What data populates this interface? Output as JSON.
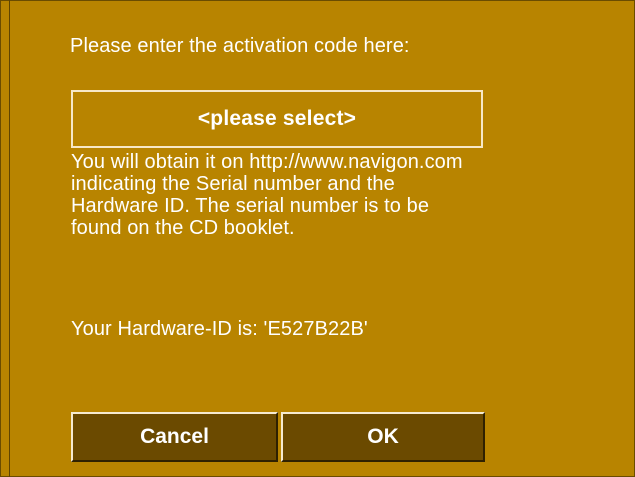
{
  "dialog": {
    "prompt": "Please enter the activation code here:",
    "code_select_label": "<please select>",
    "info_text": "You will obtain it on http://www.navigon.com indicating the Serial number and the Hardware ID. The serial number is to be found on the CD booklet.",
    "hardware_id_text": "Your Hardware-ID is: 'E527B22B'"
  },
  "buttons": {
    "cancel_label": "Cancel",
    "ok_label": "OK"
  },
  "colors": {
    "background": "#b88400",
    "button_fill": "#6b4a00",
    "text": "#ffffff"
  }
}
